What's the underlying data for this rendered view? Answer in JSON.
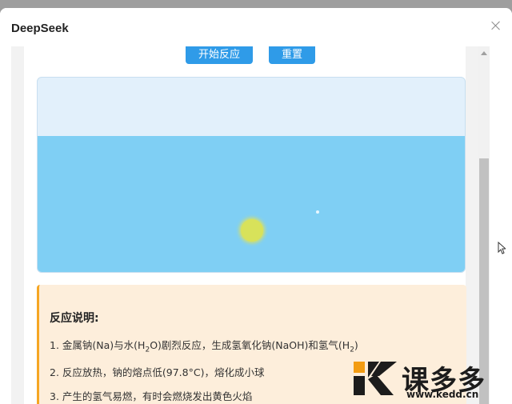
{
  "window": {
    "title": "DeepSeek",
    "close_icon": "close-icon"
  },
  "controls": {
    "start_label": "开始反应",
    "reset_label": "重置"
  },
  "simulation": {
    "colors": {
      "air": "#e2f0fb",
      "water": "#7fcff4",
      "sodium": "#d8e25a"
    }
  },
  "explanation": {
    "title": "反应说明:",
    "line1": {
      "a": "1. 金属钠(Na)与水(H",
      "sub1": "2",
      "b": "O)剧烈反应，生成氢氧化钠(NaOH)和氢气(H",
      "sub2": "2",
      "c": ")"
    },
    "line2": "2. 反应放热，钠的熔点低(97.8°C)，熔化成小球",
    "line3": "3. 产生的氢气易燃，有时会燃烧发出黄色火焰",
    "accent_color": "#f5a623"
  },
  "watermark": {
    "brand": "课多多",
    "url": "www.kedd.cn",
    "logo_icon": "k-logo-icon"
  }
}
